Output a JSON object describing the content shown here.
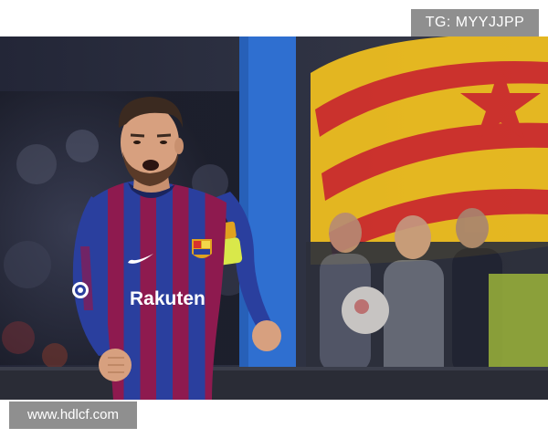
{
  "watermark_top": {
    "text": "TG: MYYJJPP"
  },
  "watermark_bottom": {
    "text": "www.hdlcf.com"
  },
  "photo": {
    "jersey_sponsor": "Rakuten",
    "colors": {
      "background_dark": "#1c1f2e",
      "post_blue": "#2f6fd0",
      "flag_yellow": "#f3c21f",
      "flag_red": "#d8322c",
      "jersey_blue": "#2a3f9e",
      "jersey_maroon": "#8e1a4f",
      "armband_yellow": "#d9e84a",
      "skin": "#d7a07f"
    }
  }
}
